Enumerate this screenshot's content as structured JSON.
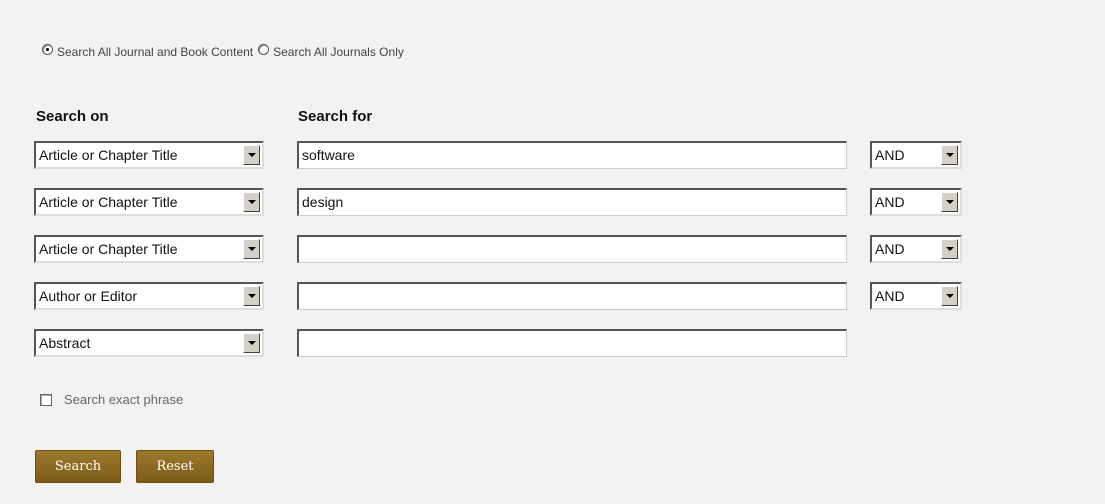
{
  "scope": {
    "options": [
      {
        "label": "Search All Journal and Book Content",
        "checked": true
      },
      {
        "label": "Search All Journals Only",
        "checked": false
      }
    ]
  },
  "headers": {
    "search_on": "Search on",
    "search_for": "Search for"
  },
  "rows": [
    {
      "field": "Article or Chapter Title",
      "text": "software",
      "operator": "AND"
    },
    {
      "field": "Article or Chapter Title",
      "text": "design",
      "operator": "AND"
    },
    {
      "field": "Article or Chapter Title",
      "text": "",
      "operator": "AND"
    },
    {
      "field": "Author or Editor",
      "text": "",
      "operator": "AND"
    },
    {
      "field": "Abstract",
      "text": "",
      "operator": null
    }
  ],
  "exact_phrase": {
    "label": "Search exact phrase",
    "checked": false
  },
  "buttons": {
    "search": "Search",
    "reset": "Reset"
  },
  "colors": {
    "button": "#8a6a22",
    "background": "#f2f2f2"
  }
}
